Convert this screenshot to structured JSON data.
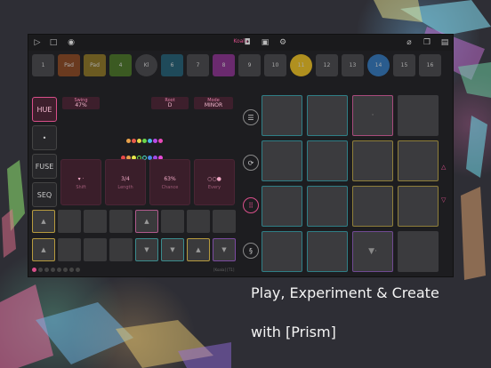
{
  "toolbar": {
    "title": "Koala"
  },
  "steps": [
    {
      "label": "1",
      "color": "#3a3a3d",
      "round": false
    },
    {
      "label": "Pad",
      "color": "#6a3a1f",
      "round": false
    },
    {
      "label": "Pad",
      "color": "#6b5a21",
      "round": false
    },
    {
      "label": "4",
      "color": "#3b5a22",
      "round": false
    },
    {
      "label": "Kl",
      "color": "#3a3a3d",
      "round": true
    },
    {
      "label": "6",
      "color": "#1f4a5a",
      "round": false
    },
    {
      "label": "7",
      "color": "#3a3a3d",
      "round": false
    },
    {
      "label": "8",
      "color": "#6a2a6e",
      "round": false
    },
    {
      "label": "9",
      "color": "#3a3a3d",
      "round": false
    },
    {
      "label": "10",
      "color": "#3a3a3d",
      "round": false
    },
    {
      "label": "11",
      "color": "#b0901f",
      "round": true
    },
    {
      "label": "12",
      "color": "#3a3a3d",
      "round": false
    },
    {
      "label": "13",
      "color": "#3a3a3d",
      "round": false
    },
    {
      "label": "14",
      "color": "#2a5c8e",
      "round": true
    },
    {
      "label": "15",
      "color": "#3a3a3d",
      "round": false
    },
    {
      "label": "16",
      "color": "#3a3a3d",
      "round": false
    }
  ],
  "left": {
    "hue_label": "HUE",
    "fuse_label": "FUSE",
    "seq_label": "SEQ",
    "swing": {
      "label": "Swing",
      "value": "47%"
    },
    "root": {
      "label": "Root",
      "value": "D"
    },
    "mode": {
      "label": "Mode",
      "value": "MINOR"
    }
  },
  "knobs": [
    {
      "value": "▾ ·",
      "label": "Shift"
    },
    {
      "value": "3/4",
      "label": "Length"
    },
    {
      "value": "63%",
      "label": "Chance"
    },
    {
      "value": "○○●",
      "label": "Every"
    }
  ],
  "footnote": "[Koala] [T1]",
  "caption": {
    "line1": "Play, Experiment & Create",
    "line2": "with [Prism]"
  },
  "colors": {
    "accent": "#d94f8a"
  }
}
